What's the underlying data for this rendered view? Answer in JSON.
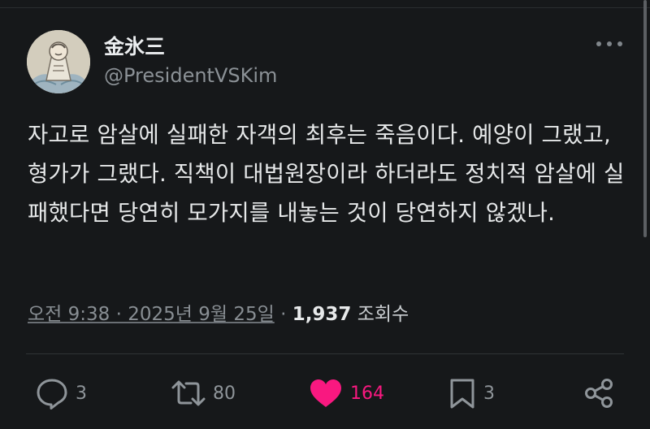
{
  "author": {
    "name": "金氷三",
    "handle": "@PresidentVSKim"
  },
  "tweet": {
    "text": "자고로 암살에 실패한 자객의 최후는 죽음이다. 예양이 그랬고, 형가가 그랬다. 직책이 대법원장이라 하더라도 정치적 암살에 실패했다면 당연히 모가지를 내놓는 것이 당연하지 않겠나."
  },
  "meta": {
    "timestamp": "오전 9:38 · 2025년 9월 25일",
    "separator": "·",
    "views_count": "1,937",
    "views_label": "조회수"
  },
  "actions": {
    "reply": {
      "icon": "reply-icon",
      "count": "3"
    },
    "retweet": {
      "icon": "retweet-icon",
      "count": "80"
    },
    "like": {
      "icon": "heart-icon",
      "count": "164",
      "active": true,
      "color": "#f91880"
    },
    "bookmark": {
      "icon": "bookmark-icon",
      "count": "3"
    },
    "share": {
      "icon": "share-icon"
    }
  },
  "colors": {
    "background": "#16181a",
    "text": "#e7e9ea",
    "secondary": "#8b9196",
    "like": "#f91880"
  }
}
